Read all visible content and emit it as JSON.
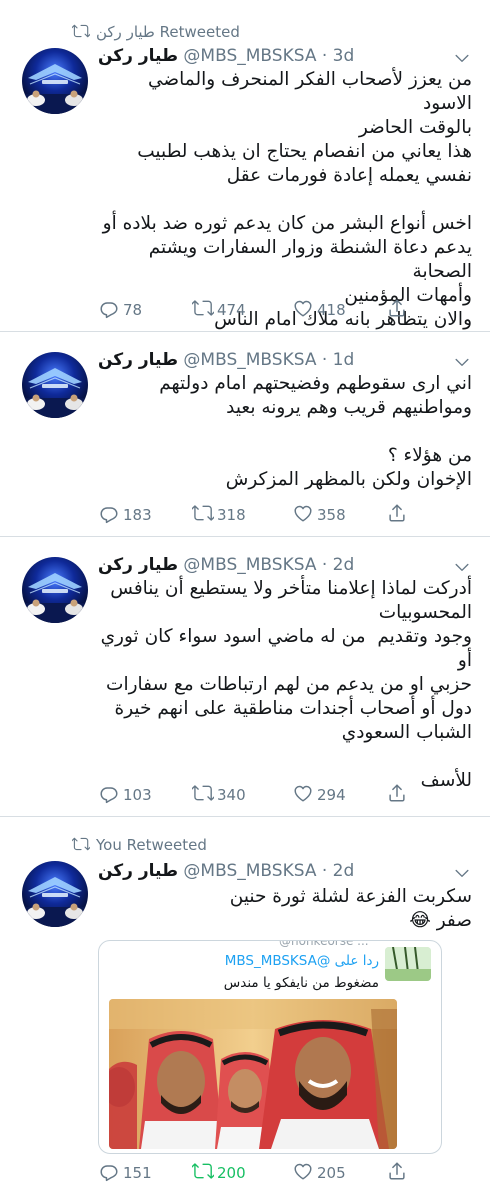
{
  "tweets": [
    {
      "retweet_label": "طيار ركن Retweeted",
      "name": "طيار ركن",
      "handle": "@MBS_MBSKSA",
      "time": "· 3d",
      "text": "من يعزز لأصحاب الفكر المنحرف والماضي الاسود\nبالوقت الحاضر\nهذا يعاني من انفصام يحتاج ان يذهب لطبيب\nنفسي يعمله إعادة فورمات عقل\n\nاخس أنواع البشر من كان يدعم ثوره ضد بلاده أو\nيدعم دعاة الشنطة وزوار السفارات ويشتم الصحابة\nوأمهات المؤمنين\nوالان يتظاهر بانه ملاك امام الناس",
      "replies": "78",
      "retweets": "474",
      "likes": "418"
    },
    {
      "name": "طيار ركن",
      "handle": "@MBS_MBSKSA",
      "time": "· 1d",
      "text": "اني ارى سقوطهم وفضيحتهم امام دولتهم\nومواطنيهم قريب وهم يرونه بعيد\n\nمن هؤلاء ؟\nالإخوان ولكن بالمظهر المزكرش",
      "replies": "183",
      "retweets": "318",
      "likes": "358"
    },
    {
      "name": "طيار ركن",
      "handle": "@MBS_MBSKSA",
      "time": "· 2d",
      "text": "أدركت لماذا إعلامنا متأخر ولا يستطيع أن ينافس\nالمحسوبيات\nوجود وتقديم  من له ماضي اسود سواء كان ثوري أو\nحزبي او من يدعم من لهم ارتباطات مع سفارات\nدول أو أصحاب أجندات مناطقية على انهم خيرة\nالشباب السعودي\n\nللأسف",
      "replies": "103",
      "retweets": "340",
      "likes": "294"
    },
    {
      "retweet_label": "You Retweeted",
      "name": "طيار ركن",
      "handle": "@MBS_MBSKSA",
      "time": "· 2d",
      "text": "سكربت الفزعة لشلة ثورة حنين\nصفر 😂",
      "replies": "151",
      "retweets": "200",
      "likes": "205",
      "quote": {
        "partial_handle": "@nonkeorse ...",
        "reply_to": "ردا على @MBS_MBSKSA",
        "text": "مضغوط من نايفكو يا مندس"
      }
    }
  ],
  "colors": {
    "text": "#14171a",
    "muted": "#657786",
    "link": "#1da1f2",
    "retweet_active": "#17bf63",
    "divider": "#d8dee3"
  },
  "icons": [
    "retweet-icon",
    "caret-down-icon",
    "reply-icon",
    "like-icon",
    "share-icon"
  ]
}
